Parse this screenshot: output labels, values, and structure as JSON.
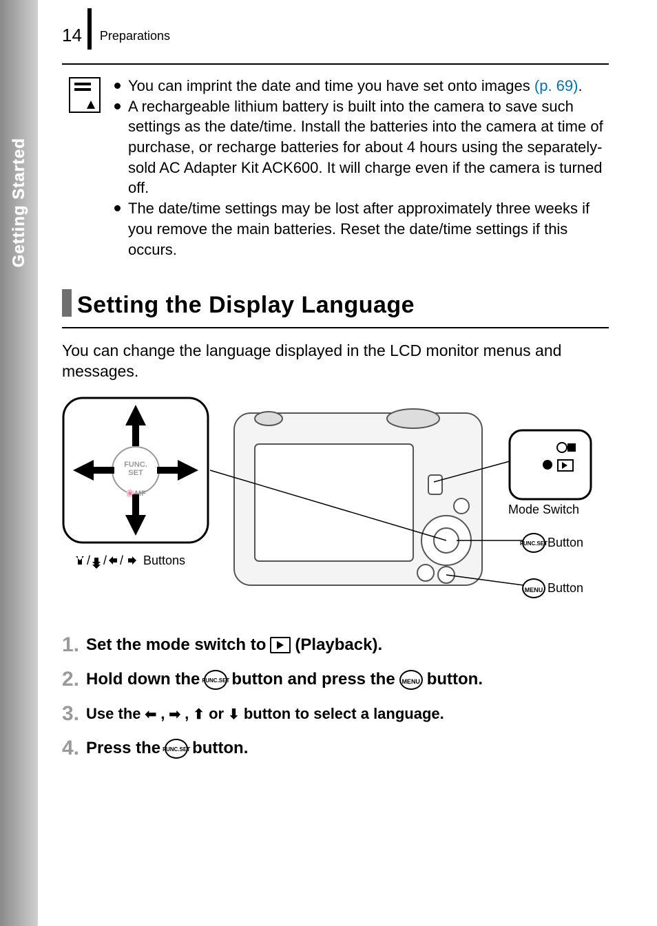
{
  "page_number": "14",
  "breadcrumb": "Preparations",
  "side_tab": "Getting Started",
  "note": {
    "item1_a": "You can imprint the date and time you have set onto images ",
    "item1_link": "(p. 69)",
    "item1_b": ".",
    "item2": "A rechargeable lithium battery is built into the camera to save such settings as the date/time. Install the batteries into the camera at time of purchase, or recharge batteries for about 4 hours using the separately-sold AC Adapter Kit ACK600. It will charge even if the camera is turned off.",
    "item3": "The date/time settings may be lost after approximately three weeks if you remove the main batteries. Reset the date/time settings if this occurs."
  },
  "section_title": "Setting the Display Language",
  "intro": "You can change the language displayed in the LCD monitor menus and messages.",
  "callouts": {
    "mode_switch": "Mode Switch",
    "func_button": " Button",
    "menu_button": " Button",
    "dpad": " Buttons"
  },
  "steps": {
    "s1_a": "Set the mode switch to ",
    "s1_b": " (Playback).",
    "s2_a": "Hold down the ",
    "s2_b": " button and press the ",
    "s2_c": " button.",
    "s3_a": "Use the ",
    "s3_b": ", ",
    "s3_c": ", ",
    "s3_d": " or ",
    "s3_e": " button to select a language.",
    "s4_a": "Press the ",
    "s4_b": " button."
  },
  "icons": {
    "func_top": "FUNC.",
    "func_bottom": "SET",
    "menu": "MENU"
  }
}
